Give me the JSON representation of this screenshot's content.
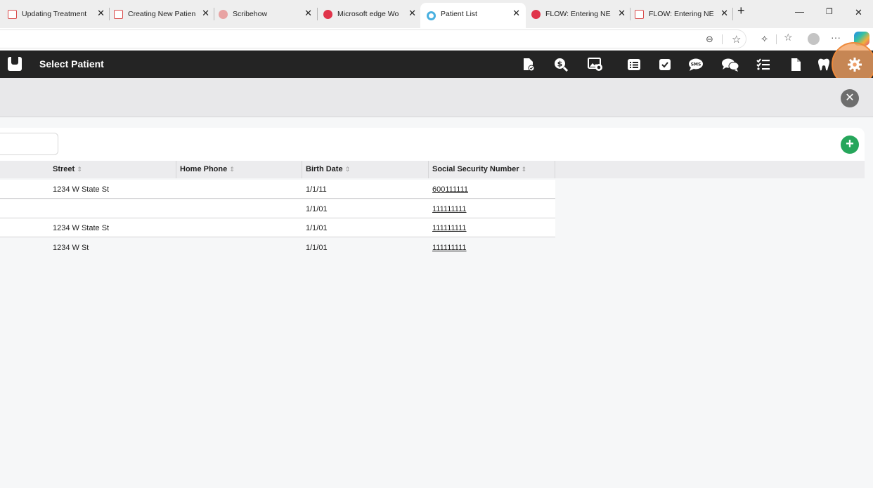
{
  "browser": {
    "tabs": [
      {
        "label": "Updating Treatment",
        "icon": "pdf-icon"
      },
      {
        "label": "Creating New Patien",
        "icon": "pdf-icon"
      },
      {
        "label": "Scribehow",
        "icon": "scribe-icon"
      },
      {
        "label": "Microsoft edge Wo",
        "icon": "scribe-icon"
      },
      {
        "label": "Patient List",
        "icon": "patient-app-icon",
        "active": true
      },
      {
        "label": "FLOW: Entering NE",
        "icon": "scribe-icon"
      },
      {
        "label": "FLOW: Entering NE",
        "icon": "pdf-icon"
      }
    ],
    "tab_close": "✕",
    "new_tab": "+",
    "window_controls": {
      "minimize": "—",
      "restore": "❐",
      "close": "✕"
    },
    "address_bar_icons": [
      "page-info-icon",
      "favorite-star-icon",
      "extensions-icon",
      "collections-icon",
      "profile-avatar",
      "more-icon",
      "copilot-icon"
    ],
    "more_label": "···"
  },
  "app": {
    "title": "Select Patient",
    "toolbar_icons": [
      "document-check-icon",
      "billing-dollar-icon",
      "image-gallery-icon",
      "list-icon",
      "checkbox-icon",
      "sms-icon",
      "chat-icon",
      "checklist-icon",
      "file-icon",
      "tooth-icon",
      "settings-gear-icon"
    ],
    "sms_label": "SMS",
    "close_label": "✕",
    "add_label": "+"
  },
  "table": {
    "sort_glyph": "⇕",
    "columns": [
      "Street",
      "Home Phone",
      "Birth Date",
      "Social Security Number"
    ],
    "rows": [
      {
        "street": "1234 W State St",
        "home_phone": "",
        "birth_date": "1/1/11",
        "ssn": "600111111"
      },
      {
        "street": "",
        "home_phone": "",
        "birth_date": "1/1/01",
        "ssn": "111111111"
      },
      {
        "street": "1234 W State St",
        "home_phone": "",
        "birth_date": "1/1/01",
        "ssn": "111111111"
      },
      {
        "street": "1234 W St",
        "home_phone": "",
        "birth_date": "1/1/01",
        "ssn": "111111111"
      }
    ]
  },
  "colors": {
    "app_header": "#242424",
    "highlight": "#f4a261",
    "add_button": "#26a65b",
    "close_button": "#6e6e6e"
  }
}
